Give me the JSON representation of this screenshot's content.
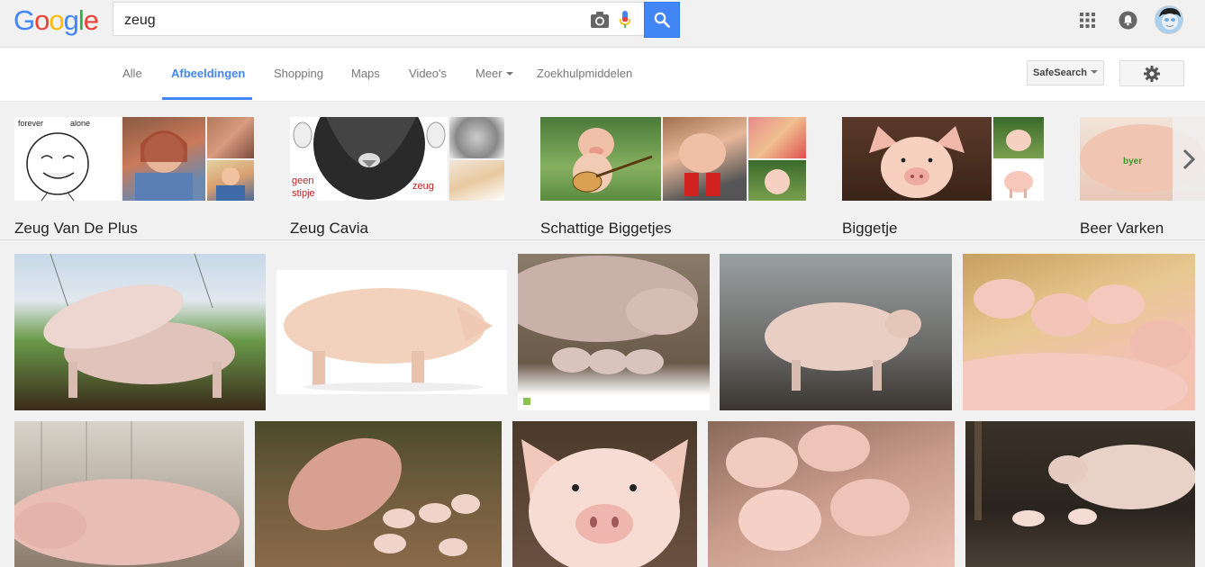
{
  "logo": {
    "letters": [
      "G",
      "o",
      "o",
      "g",
      "l",
      "e"
    ],
    "colors": [
      "#4285f4",
      "#ea4335",
      "#fbbc05",
      "#4285f4",
      "#34a853",
      "#ea4335"
    ]
  },
  "search": {
    "query": "zeug"
  },
  "icons": {
    "camera": "camera-icon",
    "mic": "microphone-icon",
    "search": "search-icon",
    "apps": "apps-grid-icon",
    "notifications": "notifications-icon",
    "settings": "gear-icon",
    "next": "chevron-right-icon"
  },
  "tabs": [
    {
      "label": "Alle",
      "active": false
    },
    {
      "label": "Afbeeldingen",
      "active": true
    },
    {
      "label": "Shopping",
      "active": false
    },
    {
      "label": "Maps",
      "active": false
    },
    {
      "label": "Video's",
      "active": false
    },
    {
      "label": "Meer",
      "active": false
    },
    {
      "label": "Zoekhulpmiddelen",
      "active": false
    }
  ],
  "safesearch_label": "SafeSearch",
  "related_searches": [
    {
      "label": "Zeug Van De Plus",
      "tile_text": [
        "forever",
        "alone"
      ]
    },
    {
      "label": "Zeug Cavia",
      "tile_text": [
        "geen",
        "stipje",
        "zeug"
      ]
    },
    {
      "label": "Schattige Biggetjes"
    },
    {
      "label": "Biggetje"
    },
    {
      "label": "Beer Varken",
      "tile_text": [
        "byer"
      ]
    }
  ],
  "results_row1": [
    "result-1",
    "result-2",
    "result-3",
    "result-4",
    "result-5"
  ],
  "results_row2": [
    "result-6",
    "result-7",
    "result-8",
    "result-9",
    "result-10"
  ],
  "colors": {
    "accent": "#4285f4",
    "background": "#f1f1f1"
  }
}
